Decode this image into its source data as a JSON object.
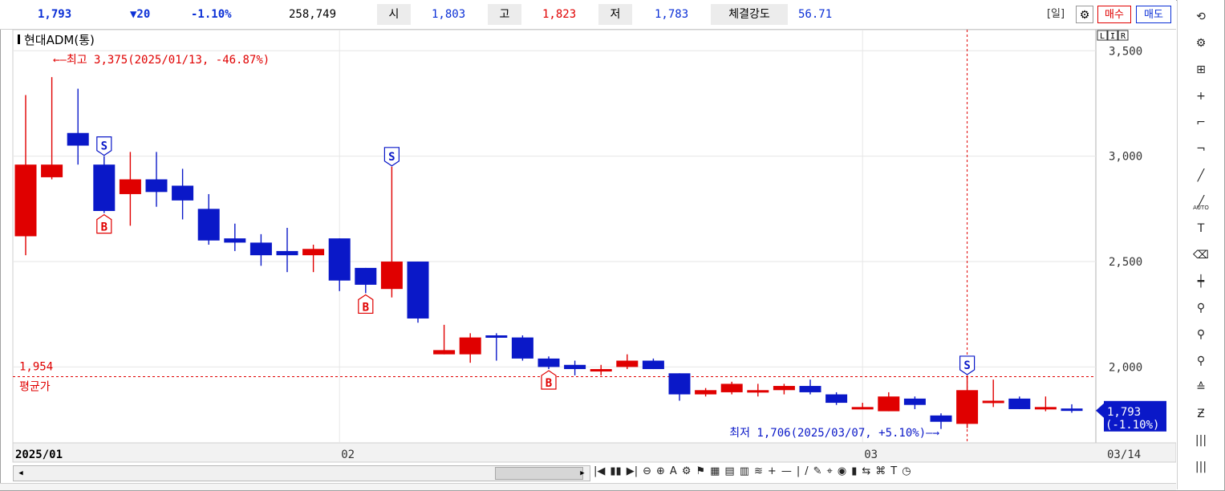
{
  "ticker": {
    "price": "1,793",
    "change": "▼20",
    "change_pct": "-1.10%",
    "volume": "258,749",
    "open_label": "시",
    "open": "1,803",
    "high_label": "고",
    "high": "1,823",
    "low_label": "저",
    "low": "1,783",
    "strength_label": "체결강도",
    "strength": "56.71"
  },
  "controls": {
    "period": "[일]",
    "buy": "매수",
    "sell": "매도",
    "settings_icon": "gear-icon"
  },
  "colors": {
    "up": "#e00000",
    "down": "#0a18c8",
    "accent": "#0a2fd6",
    "avg_line": "#e00000",
    "current_tag": "#0a18c8"
  },
  "right_toolbar": [
    "refresh-icon",
    "gear-icon",
    "chart-icon",
    "cross-cursor-icon",
    "line-start-icon",
    "line-end-icon",
    "trend-line-icon",
    "auto-trend-icon",
    "text-icon",
    "eraser-icon",
    "candle-icon",
    "zoom-in-icon",
    "zoom-list-icon",
    "zoom-range-icon",
    "fibonacci-icon",
    "z-icon",
    "bars-icon",
    "grid-icon"
  ],
  "right_toolbar_labels": {
    "auto": "AUTO"
  },
  "bottom_toolstrip": [
    "|◀",
    "▮▮",
    "▶|",
    "⊖",
    "⊕",
    "A",
    "⚙",
    "⚑",
    "▦",
    "▤",
    "▥",
    "≋",
    "+",
    "—",
    "|",
    "/",
    "✎",
    "⌖",
    "◉",
    "▮",
    "⇆",
    "⌘",
    "T",
    "◷"
  ],
  "chart_data": {
    "type": "candlestick",
    "title": "현대ADM(통)",
    "ylim": [
      1640,
      3600
    ],
    "yticks": [
      2000,
      2500,
      3000,
      3500
    ],
    "ytick_labels": [
      "2,000",
      "2,500",
      "3,000",
      "3,500"
    ],
    "xlabels": [
      {
        "label": "2025/01",
        "index": 0
      },
      {
        "label": "02",
        "index": 12.5
      },
      {
        "label": "03",
        "index": 32.5
      },
      {
        "label": "03/14",
        "index": 41.5
      }
    ],
    "grid": true,
    "candles": [
      {
        "o": 2620,
        "h": 3290,
        "l": 2530,
        "c": 2960
      },
      {
        "o": 2900,
        "h": 3375,
        "l": 2890,
        "c": 2960
      },
      {
        "o": 3110,
        "h": 3320,
        "l": 2960,
        "c": 3050
      },
      {
        "o": 2960,
        "h": 3000,
        "l": 2730,
        "c": 2740
      },
      {
        "o": 2820,
        "h": 3020,
        "l": 2670,
        "c": 2890
      },
      {
        "o": 2890,
        "h": 3020,
        "l": 2760,
        "c": 2830
      },
      {
        "o": 2860,
        "h": 2940,
        "l": 2700,
        "c": 2790
      },
      {
        "o": 2750,
        "h": 2820,
        "l": 2580,
        "c": 2600
      },
      {
        "o": 2610,
        "h": 2680,
        "l": 2550,
        "c": 2590
      },
      {
        "o": 2590,
        "h": 2630,
        "l": 2480,
        "c": 2530
      },
      {
        "o": 2550,
        "h": 2660,
        "l": 2450,
        "c": 2530
      },
      {
        "o": 2530,
        "h": 2580,
        "l": 2450,
        "c": 2560
      },
      {
        "o": 2610,
        "h": 2610,
        "l": 2360,
        "c": 2410
      },
      {
        "o": 2470,
        "h": 2470,
        "l": 2350,
        "c": 2390
      },
      {
        "o": 2370,
        "h": 2950,
        "l": 2330,
        "c": 2500
      },
      {
        "o": 2500,
        "h": 2500,
        "l": 2210,
        "c": 2230
      },
      {
        "o": 2060,
        "h": 2200,
        "l": 2060,
        "c": 2080
      },
      {
        "o": 2060,
        "h": 2160,
        "l": 2020,
        "c": 2140
      },
      {
        "o": 2150,
        "h": 2160,
        "l": 2030,
        "c": 2140
      },
      {
        "o": 2140,
        "h": 2150,
        "l": 2030,
        "c": 2040
      },
      {
        "o": 2040,
        "h": 2050,
        "l": 1990,
        "c": 2000
      },
      {
        "o": 2010,
        "h": 2030,
        "l": 1960,
        "c": 1990
      },
      {
        "o": 1990,
        "h": 2010,
        "l": 1960,
        "c": 1990
      },
      {
        "o": 2000,
        "h": 2060,
        "l": 1990,
        "c": 2030
      },
      {
        "o": 2030,
        "h": 2040,
        "l": 1990,
        "c": 1990
      },
      {
        "o": 1970,
        "h": 1970,
        "l": 1840,
        "c": 1870
      },
      {
        "o": 1870,
        "h": 1900,
        "l": 1860,
        "c": 1890
      },
      {
        "o": 1880,
        "h": 1930,
        "l": 1870,
        "c": 1920
      },
      {
        "o": 1880,
        "h": 1920,
        "l": 1860,
        "c": 1890
      },
      {
        "o": 1890,
        "h": 1920,
        "l": 1870,
        "c": 1910
      },
      {
        "o": 1910,
        "h": 1940,
        "l": 1870,
        "c": 1880
      },
      {
        "o": 1870,
        "h": 1880,
        "l": 1820,
        "c": 1830
      },
      {
        "o": 1810,
        "h": 1830,
        "l": 1800,
        "c": 1810
      },
      {
        "o": 1790,
        "h": 1880,
        "l": 1790,
        "c": 1860
      },
      {
        "o": 1850,
        "h": 1860,
        "l": 1800,
        "c": 1820
      },
      {
        "o": 1770,
        "h": 1780,
        "l": 1706,
        "c": 1740
      },
      {
        "o": 1730,
        "h": 1960,
        "l": 1710,
        "c": 1890
      },
      {
        "o": 1840,
        "h": 1940,
        "l": 1810,
        "c": 1840
      },
      {
        "o": 1850,
        "h": 1860,
        "l": 1800,
        "c": 1800
      },
      {
        "o": 1800,
        "h": 1860,
        "l": 1790,
        "c": 1810
      },
      {
        "o": 1803,
        "h": 1823,
        "l": 1783,
        "c": 1793
      }
    ],
    "signals": [
      {
        "index": 3,
        "type": "S",
        "position": "above"
      },
      {
        "index": 3,
        "type": "B",
        "position": "below"
      },
      {
        "index": 13,
        "type": "B",
        "position": "below"
      },
      {
        "index": 14,
        "type": "S",
        "position": "above"
      },
      {
        "index": 20,
        "type": "B",
        "position": "below"
      },
      {
        "index": 36,
        "type": "S",
        "position": "above"
      }
    ],
    "avg_price": 1954,
    "avg_price_label": "1,954",
    "avg_price_text": "평균가",
    "high_annotation": "←—최고 3,375(2025/01/13, -46.87%)",
    "low_annotation": "최저 1,706(2025/03/07, +5.10%)—→",
    "current_price_label": "1,793",
    "current_pct_label": "(-1.10%)",
    "crosshair_index": 36,
    "lr_buttons": [
      "L",
      "I",
      "R"
    ]
  }
}
